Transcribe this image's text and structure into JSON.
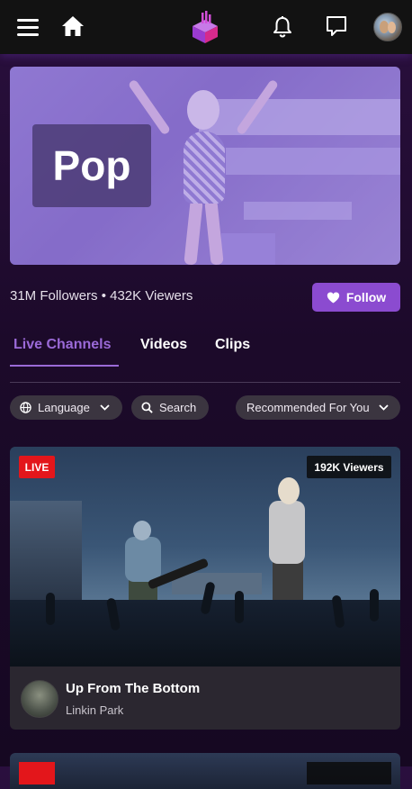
{
  "category": {
    "title": "Pop",
    "stats": "31M Followers • 432K Viewers",
    "follow_label": "Follow"
  },
  "tabs": [
    {
      "label": "Live Channels",
      "active": true
    },
    {
      "label": "Videos",
      "active": false
    },
    {
      "label": "Clips",
      "active": false
    }
  ],
  "filters": {
    "language_label": "Language",
    "search_label": "Search",
    "sort_label": "Recommended For You"
  },
  "streams": [
    {
      "live_label": "LIVE",
      "viewers": "192K Viewers",
      "title": "Up From The Bottom",
      "channel": "Linkin Park"
    }
  ],
  "colors": {
    "accent": "#8b4bd0",
    "tab_active": "#9b6ad8",
    "live_red": "#e3161b",
    "nav_bg": "#121212"
  },
  "icons": [
    "hamburger-menu-icon",
    "home-icon",
    "app-logo-icon",
    "bell-icon",
    "chat-icon",
    "globe-icon",
    "search-icon",
    "chevron-down-icon",
    "heart-icon"
  ]
}
